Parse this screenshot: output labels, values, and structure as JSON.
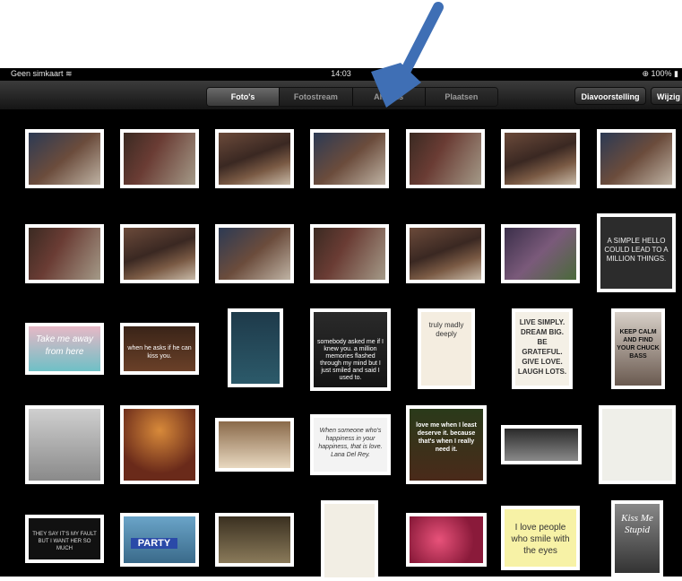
{
  "status_bar": {
    "carrier": "Geen simkaart",
    "time": "14:03",
    "battery": "100%"
  },
  "toolbar": {
    "tabs": [
      {
        "label": "Foto's",
        "active": true
      },
      {
        "label": "Fotostream",
        "active": false
      },
      {
        "label": "Albums",
        "active": false
      },
      {
        "label": "Plaatsen",
        "active": false
      }
    ],
    "slideshow_label": "Diavoorstelling",
    "edit_label": "Wijzig"
  },
  "colors": {
    "arrow": "#3f6fb5",
    "background": "#000000",
    "thumb_border": "#ffffff"
  },
  "thumb_texts": {
    "hello": "A SIMPLE HELLO COULD LEAD TO A MILLION THINGS.",
    "take": "Take me away from here",
    "kiss": "when he asks if he can kiss you.",
    "somebody": "somebody asked me if I knew you. a million memories flashed through my mind but I just smiled and said I used to.",
    "truly": "truly madly deeply",
    "live": "LIVE SIMPLY. DREAM BIG. BE GRATEFUL. GIVE LOVE. LAUGH LOTS.",
    "keepcalm": "KEEP CALM AND FIND YOUR CHUCK BASS",
    "lana": "When someone who's happiness in your happiness, that is love. Lana Del Rey.",
    "mickey": "love me when I least deserve it. because that's when I really need it.",
    "fault": "THEY SAY IT'S MY FAULT BUT I WANT HER SO MUCH",
    "party": "PARTY",
    "smile": "I love people who smile with the eyes",
    "kissme": "Kiss Me Stupid"
  }
}
